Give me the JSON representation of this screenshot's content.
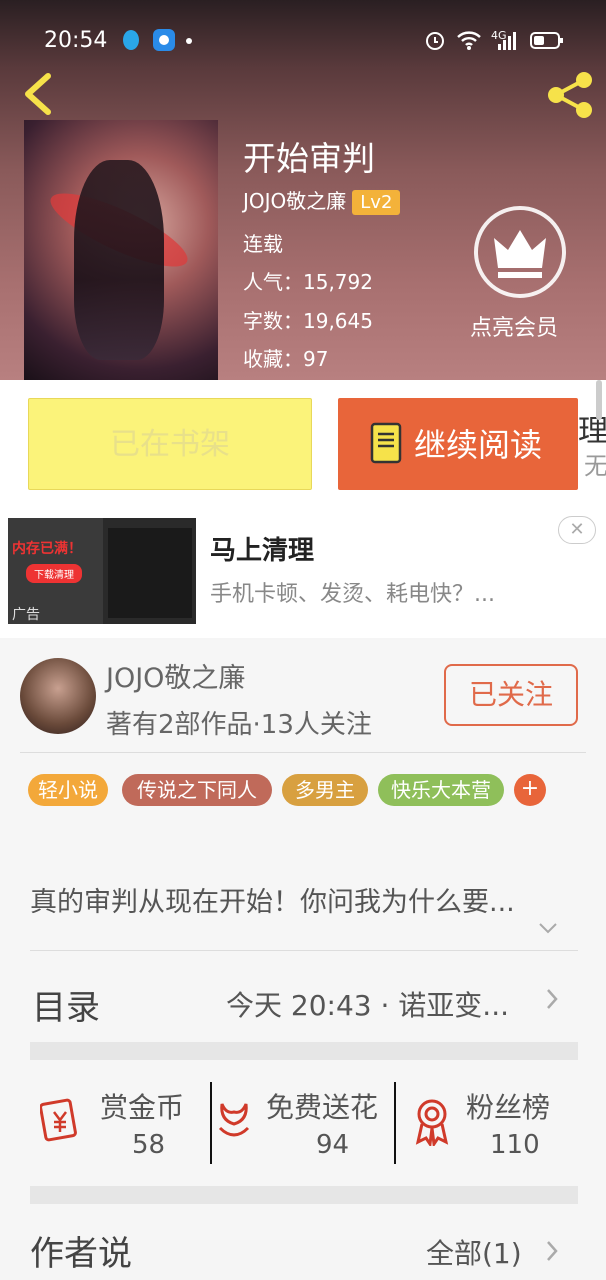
{
  "status_bar": {
    "time": "20:54",
    "network": "4G"
  },
  "book": {
    "title": "开始审判",
    "author": "JOJO敬之廉",
    "level": "Lv2",
    "status": "连载",
    "popularity": "人气：15,792",
    "words": "字数：19,645",
    "collections": "收藏：97",
    "vip_label": "点亮会员"
  },
  "actions": {
    "shelf_label": "已在书架",
    "read_label": "继续阅读",
    "clipped_1": "理",
    "clipped_2": "无"
  },
  "ad": {
    "title": "马上清理",
    "description": "手机卡顿、发烫、耗电快？...",
    "image_text": "内存已满！",
    "image_button": "下载清理",
    "tag": "广告",
    "close": "✕"
  },
  "author": {
    "name": "JOJO敬之廉",
    "stats": "著有2部作品·13人关注",
    "follow_label": "已关注"
  },
  "tags": [
    {
      "label": "轻小说",
      "color": "#f3a83a"
    },
    {
      "label": "传说之下同人",
      "color": "#c06a5a"
    },
    {
      "label": "多男主",
      "color": "#d8a040"
    },
    {
      "label": "快乐大本营",
      "color": "#8fbf5a"
    }
  ],
  "tag_more": "+",
  "intro": "真的审判从现在开始！你问我为什么要...",
  "toc": {
    "label": "目录",
    "update": "今天 20:43 · 诺亚变..."
  },
  "rewards": [
    {
      "label": "赏金币",
      "value": "58",
      "icon": "red-envelope-icon"
    },
    {
      "label": "免费送花",
      "value": "94",
      "icon": "flower-icon"
    },
    {
      "label": "粉丝榜",
      "value": "110",
      "icon": "medal-icon"
    }
  ],
  "author_says": {
    "label": "作者说",
    "all": "全部(1)"
  },
  "colors": {
    "accent": "#e8653a",
    "shelf": "#fbf37a",
    "level": "#f3b23a"
  }
}
